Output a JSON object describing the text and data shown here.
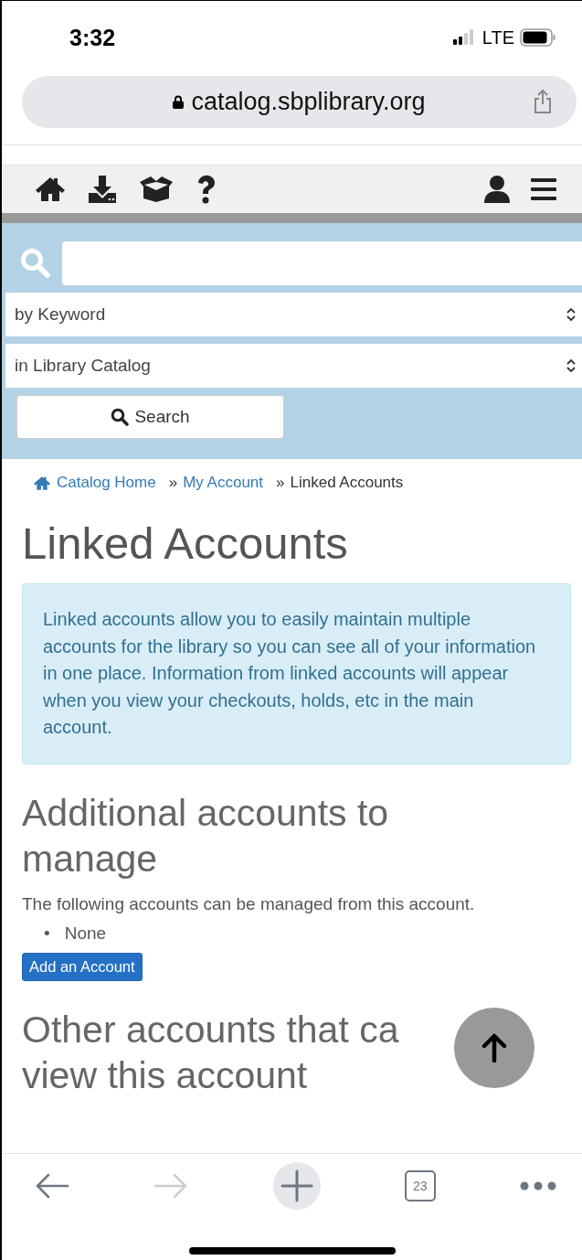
{
  "status_bar": {
    "time": "3:32",
    "network": "LTE"
  },
  "address_bar": {
    "url": "catalog.sbplibrary.org"
  },
  "search": {
    "type_select": "by Keyword",
    "scope_select": "in Library Catalog",
    "button": "Search"
  },
  "breadcrumb": [
    {
      "label": "Catalog Home",
      "kind": "home",
      "link": true
    },
    {
      "separator": "»",
      "label": "My Account",
      "kind": "link",
      "link": true
    },
    {
      "separator": "»",
      "label": "Linked Accounts",
      "kind": "current",
      "link": false
    }
  ],
  "page_title": "Linked Accounts",
  "info_alert": "Linked accounts allow you to easily maintain multiple accounts for the library so you can see all of your information in one place. Information from linked accounts will appear when you view your checkouts, holds, etc in the main account.",
  "sections": [
    {
      "heading": [
        "Additional accounts to",
        "manage"
      ],
      "description": "The following accounts can be managed from this account.",
      "items": [
        {
          "bullet": "•",
          "text": "None"
        }
      ],
      "button": "Add an Account"
    },
    {
      "heading": [
        "Other accounts that ca",
        "view this account"
      ]
    }
  ],
  "toolbar": {
    "back_disabled": false,
    "forward_disabled": true,
    "tab_count": "23"
  }
}
